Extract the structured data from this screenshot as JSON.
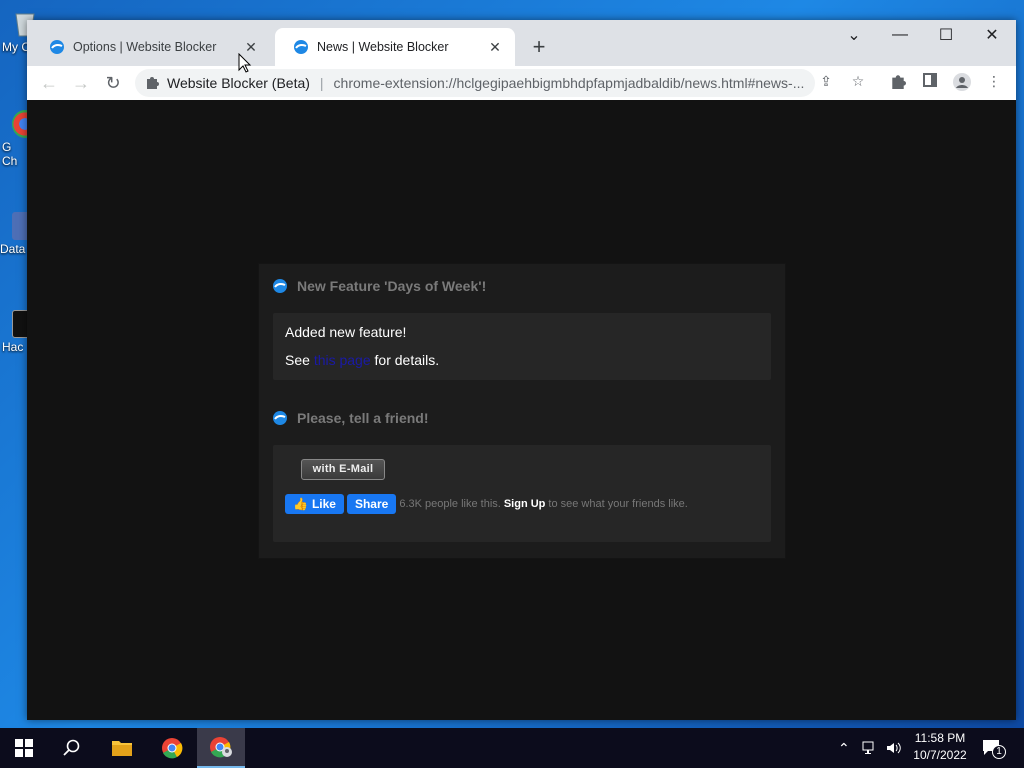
{
  "desktop": {
    "icons": [
      {
        "label": "My C",
        "name": "recycle-bin"
      },
      {
        "label": "G\nCh",
        "name": "google-chrome"
      },
      {
        "label": "Data",
        "name": "data"
      },
      {
        "label": "Hac",
        "name": "hack"
      }
    ]
  },
  "browser": {
    "tabs": [
      {
        "title": "Options | Website Blocker",
        "active": false
      },
      {
        "title": "News | Website Blocker",
        "active": true
      }
    ],
    "new_tab_label": "+",
    "omnibox": {
      "ext_name": "Website Blocker (Beta)",
      "separator": "|",
      "url": "chrome-extension://hclgegipaehbigmbhdpfapmjadbaldib/news.html#news-..."
    }
  },
  "page": {
    "feature": {
      "title": "New Feature 'Days of Week'!",
      "line1": "Added new feature!",
      "see": "See",
      "link": "this page",
      "details": " for details."
    },
    "share": {
      "title": "Please, tell a friend!",
      "email_button": "with E-Mail",
      "fb_like": "Like",
      "fb_share": "Share",
      "fb_count": "6.3K people like this.",
      "fb_signup": "Sign Up",
      "fb_rest": "to see what your friends like."
    }
  },
  "taskbar": {
    "time": "11:58 PM",
    "date": "10/7/2022",
    "notification_count": "1"
  },
  "colors": {
    "desktop_bg": "#1565c0",
    "page_bg": "#121212",
    "panel_bg": "#1c1c1c",
    "box_bg": "#262626",
    "facebook_blue": "#1877f2"
  }
}
